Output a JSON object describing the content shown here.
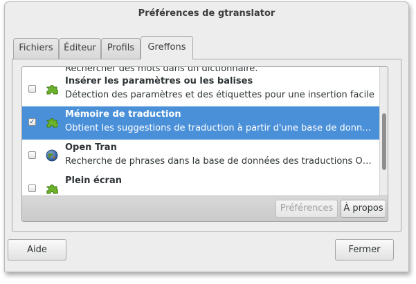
{
  "window": {
    "title": "Préférences de gtranslator"
  },
  "tabs": [
    {
      "label": "Fichiers",
      "active": false
    },
    {
      "label": "Éditeur",
      "active": false
    },
    {
      "label": "Profils",
      "active": false
    },
    {
      "label": "Greffons",
      "active": true
    }
  ],
  "plugins": {
    "partial_top_text": "Rechercher des mots dans un dictionnaire.",
    "items": [
      {
        "name": "Insérer les paramètres ou les balises",
        "description": "Détection des paramètres et des étiquettes pour une insertion facile",
        "enabled": false,
        "icon": "puzzle-icon",
        "selected": false
      },
      {
        "name": "Mémoire de traduction",
        "description": "Obtient les suggestions de traduction à partir d'une base de données",
        "enabled": true,
        "icon": "puzzle-icon",
        "selected": true
      },
      {
        "name": "Open Tran",
        "description": "Recherche de phrases dans la base de données des traductions Open-Tran",
        "enabled": false,
        "icon": "globe-icon",
        "selected": false
      },
      {
        "name": "Plein écran",
        "enabled": false,
        "icon": "puzzle-icon",
        "selected": false
      }
    ],
    "preferences_button": "Préférences",
    "about_button": "À propos"
  },
  "dialog_buttons": {
    "help": "Aide",
    "close": "Fermer"
  },
  "colors": {
    "selection": "#4a90d9",
    "puzzle_green": "#6cb12b",
    "window_bg": "#ededed"
  },
  "checkmark": "✓"
}
